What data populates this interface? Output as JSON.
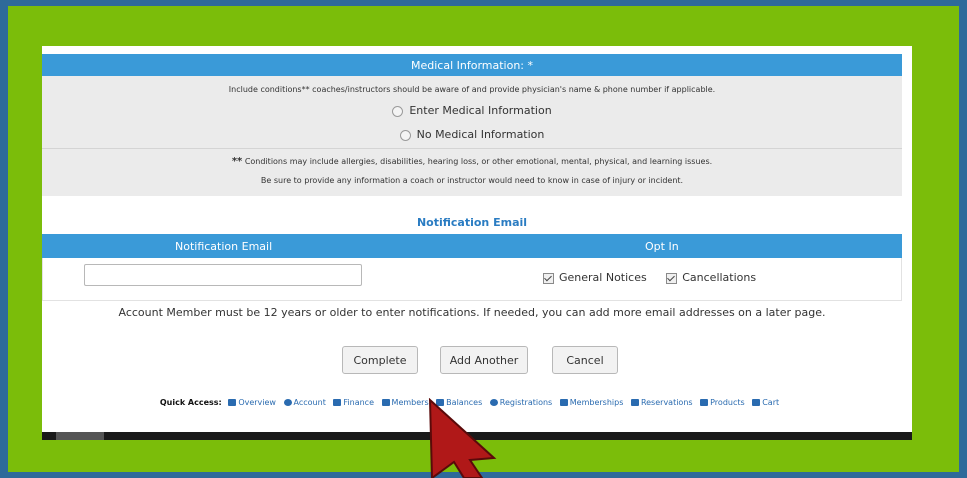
{
  "medical": {
    "header": "Medical Information: *",
    "instructions": "Include conditions** coaches/instructors should be aware of and provide physician's name & phone number if applicable.",
    "option_enter": "Enter Medical Information",
    "option_none": "No Medical Information",
    "note_marker": "**",
    "note_line1": "Conditions may include allergies, disabilities, hearing loss, or other emotional, mental, physical, and learning issues.",
    "note_line2": "Be sure to provide any information a coach or instructor would need to know in case of injury or incident."
  },
  "notification": {
    "section_title": "Notification Email",
    "col_email": "Notification Email",
    "col_optin": "Opt In",
    "email_value": "",
    "general_notices": "General Notices",
    "cancellations": "Cancellations",
    "age_note": "Account Member must be 12 years or older to enter notifications. If needed, you can add more email addresses on a later page."
  },
  "buttons": {
    "complete": "Complete",
    "add_another": "Add Another",
    "cancel": "Cancel"
  },
  "quick_access": {
    "label": "Quick Access:",
    "items": [
      "Overview",
      "Account",
      "Finance",
      "Members",
      "Balances",
      "Registrations",
      "Memberships",
      "Reservations",
      "Products",
      "Cart"
    ]
  },
  "colors": {
    "header_blue": "#3a9ad8",
    "link_blue": "#2a6bb0",
    "frame_green": "#7bbd0a",
    "outer_blue": "#2e6a9a",
    "cursor_red": "#b01818"
  }
}
